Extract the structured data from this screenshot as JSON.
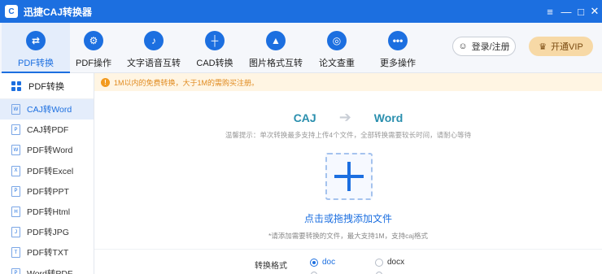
{
  "window": {
    "title": "迅捷CAJ转换器",
    "controls": [
      "≡",
      "—",
      "□",
      "✕"
    ]
  },
  "toolbar": {
    "tools": [
      {
        "label": "PDF转换",
        "icon": "⇄",
        "active": true
      },
      {
        "label": "PDF操作",
        "icon": "⚙"
      },
      {
        "label": "文字语音互转",
        "icon": "♪"
      },
      {
        "label": "CAD转换",
        "icon": "┼"
      },
      {
        "label": "图片格式互转",
        "icon": "▲"
      },
      {
        "label": "论文查重",
        "icon": "◎"
      },
      {
        "label": "更多操作",
        "icon": "•••"
      }
    ],
    "login_label": "登录/注册",
    "vip_label": "开通VIP"
  },
  "sidebar": {
    "header": "PDF转换",
    "items": [
      {
        "label": "CAJ转Word",
        "active": true
      },
      {
        "label": "CAJ转PDF"
      },
      {
        "label": "PDF转Word"
      },
      {
        "label": "PDF转Excel"
      },
      {
        "label": "PDF转PPT"
      },
      {
        "label": "PDF转Html"
      },
      {
        "label": "PDF转JPG"
      },
      {
        "label": "PDF转TXT"
      },
      {
        "label": "Word转PDF"
      }
    ]
  },
  "notice": {
    "text": "1M以内的免费转换，大于1M的需购买注册。"
  },
  "converter": {
    "from": "CAJ",
    "to": "Word",
    "tip": "温馨提示：单次转换最多支持上传4个文件，全部转换需要较长时间，请耐心等待",
    "drop_label": "点击或拖拽添加文件",
    "drop_hint": "*请添加需要转换的文件，最大支持1M，支持caj格式"
  },
  "format": {
    "label": "转换格式",
    "options": [
      {
        "label": "doc",
        "selected": true
      },
      {
        "label": "docx",
        "selected": false
      }
    ]
  },
  "colors": {
    "brand": "#1c6fe0",
    "accent_teal": "#2a8fae",
    "notice_text": "#e08a1e"
  }
}
